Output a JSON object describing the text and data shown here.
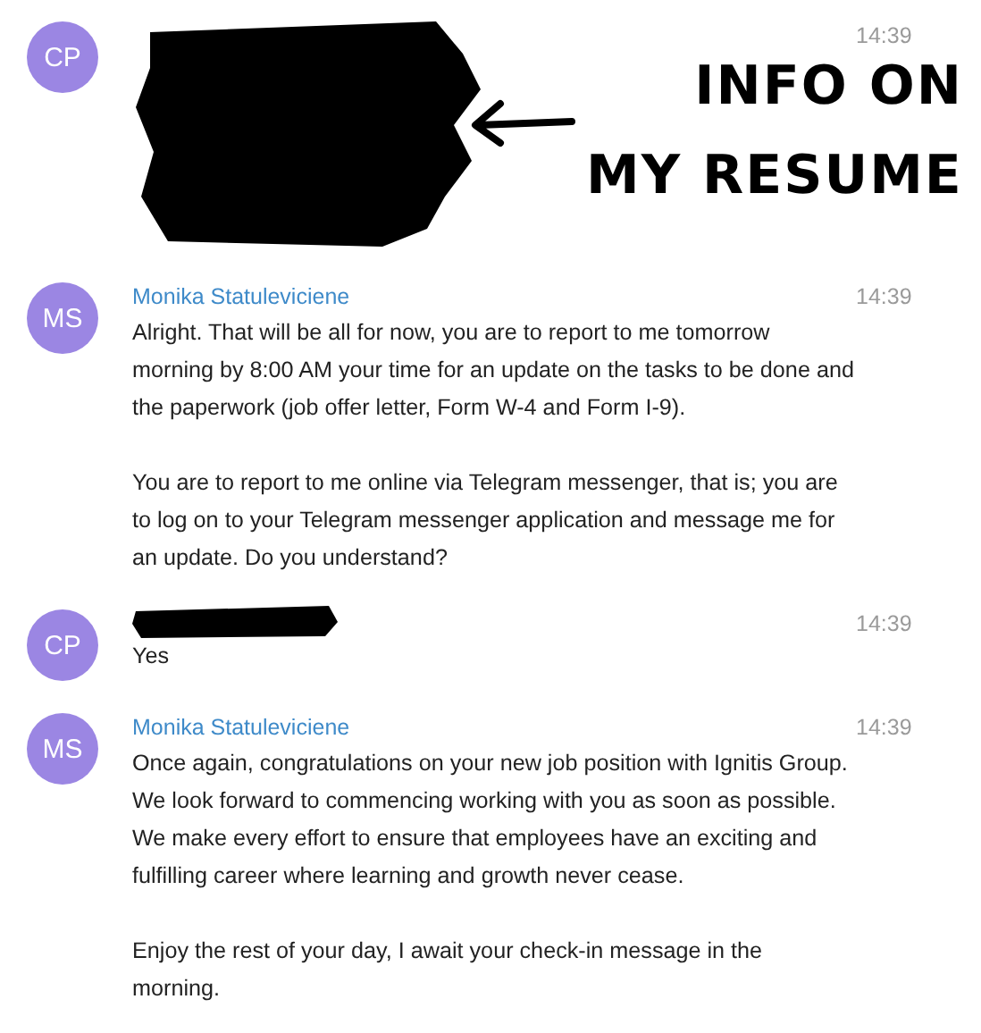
{
  "messages": [
    {
      "initials": "CP",
      "time": "14:39",
      "name_redacted": true,
      "body_redacted": true
    },
    {
      "initials": "MS",
      "time": "14:39",
      "name": "Monika Statuleviciene",
      "name_redacted": false,
      "body_redacted": false,
      "paragraphs": [
        "Alright. That will be all for now, you are to report to me tomorrow morning by 8:00 AM your time for an update on the tasks to be done and the paperwork (job offer letter, Form W-4 and Form I-9).",
        "You are to report to me online via Telegram messenger, that is; you are to log on to your Telegram messenger application and message me for an update. Do you understand?"
      ]
    },
    {
      "initials": "CP",
      "time": "14:39",
      "name_redacted": true,
      "body_redacted": false,
      "paragraphs": [
        "Yes"
      ]
    },
    {
      "initials": "MS",
      "time": "14:39",
      "name": "Monika Statuleviciene",
      "name_redacted": false,
      "body_redacted": false,
      "paragraphs": [
        "Once again, congratulations on your new job position with Ignitis Group. We look forward to commencing working with you as soon as possible. We make every effort to ensure that employees have an exciting and fulfilling career where learning and growth never cease.",
        "Enjoy the rest of your day, I await your check-in message in the morning."
      ]
    }
  ],
  "annotation": {
    "lines": [
      "INFO ON",
      "MY RESUME"
    ]
  }
}
